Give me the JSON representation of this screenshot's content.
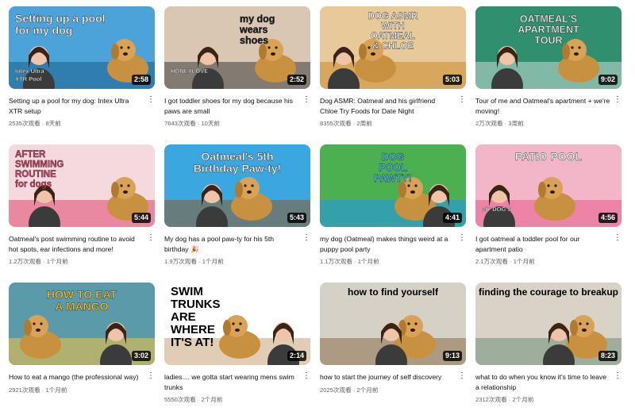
{
  "videos": [
    {
      "title": "Setting up a pool for my dog: Intex Ultra XTR setup",
      "views": "2535次观看",
      "dot": "·",
      "age": "8天前",
      "duration": "2:58",
      "overlay": [
        "Setting up a pool",
        "for my dog"
      ],
      "overlay2": [
        "Intex Ultra",
        "XTR Pool"
      ],
      "colors": {
        "bg": "#4ba3d9",
        "accent": "#1b5e8c",
        "text": "#ffffff"
      }
    },
    {
      "title": "I got toddler shoes for my dog because his paws are small",
      "views": "7643次观看",
      "dot": "·",
      "age": "10天前",
      "duration": "2:52",
      "overlay": [
        "my dog",
        "wears",
        "shoes"
      ],
      "overlay2": [
        "HONEYLOVE"
      ],
      "colors": {
        "bg": "#d9c7b3",
        "accent": "#3d3d3d",
        "text": "#1a1a1a"
      }
    },
    {
      "title": "Dog ASMR: Oatmeal and his girlfriend Chloe Try Foods for Date Night",
      "views": "8355次观看",
      "dot": "·",
      "age": "2周前",
      "duration": "5:03",
      "overlay": [
        "DOG ASMR",
        "WITH",
        "OATMEAL",
        "& CHLOE"
      ],
      "overlay2": [],
      "colors": {
        "bg": "#e8c99a",
        "accent": "#c98a2e",
        "text": "#ffffff"
      }
    },
    {
      "title": "Tour of me and Oatmeal's apartment + we're moving!",
      "views": "2万次观看",
      "dot": "·",
      "age": "3周前",
      "duration": "9:02",
      "overlay": [
        "OATMEAL'S",
        "APARTMENT",
        "TOUR"
      ],
      "overlay2": [],
      "colors": {
        "bg": "#2f8f6f",
        "accent": "#c7ddd4",
        "text": "#ffffff"
      }
    },
    {
      "title": "Oatmeal's post swimming routine to avoid hot spots, ear infections and more!",
      "views": "1.2万次观看",
      "dot": "·",
      "age": "1个月前",
      "duration": "5:44",
      "overlay": [
        "AFTER",
        "SWIMMING",
        "ROUTINE",
        "for dogs"
      ],
      "overlay2": [],
      "colors": {
        "bg": "#f6d9df",
        "accent": "#e0456a",
        "text": "#e0456a"
      }
    },
    {
      "title": "My dog has a pool paw-ty for his 5th birthday 🎉",
      "views": "1.9万次观看",
      "dot": "·",
      "age": "1个月前",
      "duration": "5:43",
      "overlay": [
        "Oatmeal's 5th",
        "Birthday Paw-ty!"
      ],
      "overlay2": [],
      "colors": {
        "bg": "#3aa7e0",
        "accent": "#8b5a2b",
        "text": "#ffffff"
      }
    },
    {
      "title": "my dog (Oatmeal) makes things weird at a puppy pool party",
      "views": "1.1万次观看",
      "dot": "·",
      "age": "1个月前",
      "duration": "4:41",
      "overlay": [
        "DOG",
        "POOL",
        "PAWTY!"
      ],
      "overlay2": [],
      "colors": {
        "bg": "#4caf50",
        "accent": "#2196f3",
        "text": "#4fc3f7"
      }
    },
    {
      "title": "I got oatmeal a toddler pool for our apartment patio",
      "views": "2.1万次观看",
      "dot": "·",
      "age": "1个月前",
      "duration": "4:56",
      "overlay": [
        "PATIO POOL"
      ],
      "overlay2": [
        "MY DOG'S"
      ],
      "colors": {
        "bg": "#f3b6c8",
        "accent": "#e85a8a",
        "text": "#ffffff"
      }
    },
    {
      "title": "How to eat a mango (the professional way)",
      "views": "2921次观看",
      "dot": "·",
      "age": "1个月前",
      "duration": "3:02",
      "overlay": [
        "HOW TO EAT",
        "A MANGO"
      ],
      "overlay2": [],
      "colors": {
        "bg": "#5b9aa8",
        "accent": "#f5c542",
        "text": "#f5c542"
      }
    },
    {
      "title": "ladies.... we gotta start wearing mens swim trunks",
      "views": "5550次观看",
      "dot": "·",
      "age": "2个月前",
      "duration": "2:14",
      "overlay": [
        "SWIM",
        "TRUNKS",
        "ARE",
        "WHERE",
        "IT'S AT!"
      ],
      "overlay2": [],
      "colors": {
        "bg": "#ffffff",
        "accent": "#c9a27a",
        "text": "#000000"
      }
    },
    {
      "title": "how to start the journey of self discovery",
      "views": "2025次观看",
      "dot": "·",
      "age": "2个月前",
      "duration": "9:13",
      "overlay": [
        "how to find yourself"
      ],
      "overlay2": [],
      "colors": {
        "bg": "#d6d1c7",
        "accent": "#8a6d4b",
        "text": "#000000"
      }
    },
    {
      "title": "what to do when you know it's time to leave a relationship",
      "views": "2312次观看",
      "dot": "·",
      "age": "2个月前",
      "duration": "8:23",
      "overlay": [
        "finding the courage to breakup"
      ],
      "overlay2": [],
      "colors": {
        "bg": "#d9d2c6",
        "accent": "#6f8f7a",
        "text": "#000000"
      }
    }
  ],
  "menu_glyph": "⋮"
}
